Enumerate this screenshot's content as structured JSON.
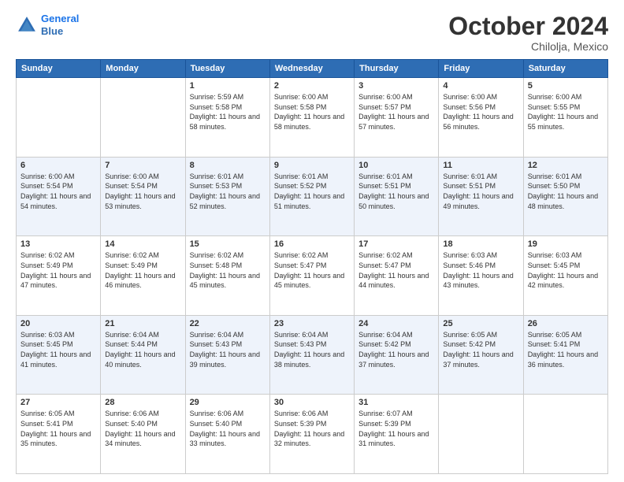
{
  "header": {
    "logo_line1": "General",
    "logo_line2": "Blue",
    "month": "October 2024",
    "location": "Chilolja, Mexico"
  },
  "days_of_week": [
    "Sunday",
    "Monday",
    "Tuesday",
    "Wednesday",
    "Thursday",
    "Friday",
    "Saturday"
  ],
  "weeks": [
    [
      {
        "day": "",
        "text": ""
      },
      {
        "day": "",
        "text": ""
      },
      {
        "day": "1",
        "text": "Sunrise: 5:59 AM\nSunset: 5:58 PM\nDaylight: 11 hours and 58 minutes."
      },
      {
        "day": "2",
        "text": "Sunrise: 6:00 AM\nSunset: 5:58 PM\nDaylight: 11 hours and 58 minutes."
      },
      {
        "day": "3",
        "text": "Sunrise: 6:00 AM\nSunset: 5:57 PM\nDaylight: 11 hours and 57 minutes."
      },
      {
        "day": "4",
        "text": "Sunrise: 6:00 AM\nSunset: 5:56 PM\nDaylight: 11 hours and 56 minutes."
      },
      {
        "day": "5",
        "text": "Sunrise: 6:00 AM\nSunset: 5:55 PM\nDaylight: 11 hours and 55 minutes."
      }
    ],
    [
      {
        "day": "6",
        "text": "Sunrise: 6:00 AM\nSunset: 5:54 PM\nDaylight: 11 hours and 54 minutes."
      },
      {
        "day": "7",
        "text": "Sunrise: 6:00 AM\nSunset: 5:54 PM\nDaylight: 11 hours and 53 minutes."
      },
      {
        "day": "8",
        "text": "Sunrise: 6:01 AM\nSunset: 5:53 PM\nDaylight: 11 hours and 52 minutes."
      },
      {
        "day": "9",
        "text": "Sunrise: 6:01 AM\nSunset: 5:52 PM\nDaylight: 11 hours and 51 minutes."
      },
      {
        "day": "10",
        "text": "Sunrise: 6:01 AM\nSunset: 5:51 PM\nDaylight: 11 hours and 50 minutes."
      },
      {
        "day": "11",
        "text": "Sunrise: 6:01 AM\nSunset: 5:51 PM\nDaylight: 11 hours and 49 minutes."
      },
      {
        "day": "12",
        "text": "Sunrise: 6:01 AM\nSunset: 5:50 PM\nDaylight: 11 hours and 48 minutes."
      }
    ],
    [
      {
        "day": "13",
        "text": "Sunrise: 6:02 AM\nSunset: 5:49 PM\nDaylight: 11 hours and 47 minutes."
      },
      {
        "day": "14",
        "text": "Sunrise: 6:02 AM\nSunset: 5:49 PM\nDaylight: 11 hours and 46 minutes."
      },
      {
        "day": "15",
        "text": "Sunrise: 6:02 AM\nSunset: 5:48 PM\nDaylight: 11 hours and 45 minutes."
      },
      {
        "day": "16",
        "text": "Sunrise: 6:02 AM\nSunset: 5:47 PM\nDaylight: 11 hours and 45 minutes."
      },
      {
        "day": "17",
        "text": "Sunrise: 6:02 AM\nSunset: 5:47 PM\nDaylight: 11 hours and 44 minutes."
      },
      {
        "day": "18",
        "text": "Sunrise: 6:03 AM\nSunset: 5:46 PM\nDaylight: 11 hours and 43 minutes."
      },
      {
        "day": "19",
        "text": "Sunrise: 6:03 AM\nSunset: 5:45 PM\nDaylight: 11 hours and 42 minutes."
      }
    ],
    [
      {
        "day": "20",
        "text": "Sunrise: 6:03 AM\nSunset: 5:45 PM\nDaylight: 11 hours and 41 minutes."
      },
      {
        "day": "21",
        "text": "Sunrise: 6:04 AM\nSunset: 5:44 PM\nDaylight: 11 hours and 40 minutes."
      },
      {
        "day": "22",
        "text": "Sunrise: 6:04 AM\nSunset: 5:43 PM\nDaylight: 11 hours and 39 minutes."
      },
      {
        "day": "23",
        "text": "Sunrise: 6:04 AM\nSunset: 5:43 PM\nDaylight: 11 hours and 38 minutes."
      },
      {
        "day": "24",
        "text": "Sunrise: 6:04 AM\nSunset: 5:42 PM\nDaylight: 11 hours and 37 minutes."
      },
      {
        "day": "25",
        "text": "Sunrise: 6:05 AM\nSunset: 5:42 PM\nDaylight: 11 hours and 37 minutes."
      },
      {
        "day": "26",
        "text": "Sunrise: 6:05 AM\nSunset: 5:41 PM\nDaylight: 11 hours and 36 minutes."
      }
    ],
    [
      {
        "day": "27",
        "text": "Sunrise: 6:05 AM\nSunset: 5:41 PM\nDaylight: 11 hours and 35 minutes."
      },
      {
        "day": "28",
        "text": "Sunrise: 6:06 AM\nSunset: 5:40 PM\nDaylight: 11 hours and 34 minutes."
      },
      {
        "day": "29",
        "text": "Sunrise: 6:06 AM\nSunset: 5:40 PM\nDaylight: 11 hours and 33 minutes."
      },
      {
        "day": "30",
        "text": "Sunrise: 6:06 AM\nSunset: 5:39 PM\nDaylight: 11 hours and 32 minutes."
      },
      {
        "day": "31",
        "text": "Sunrise: 6:07 AM\nSunset: 5:39 PM\nDaylight: 11 hours and 31 minutes."
      },
      {
        "day": "",
        "text": ""
      },
      {
        "day": "",
        "text": ""
      }
    ]
  ]
}
